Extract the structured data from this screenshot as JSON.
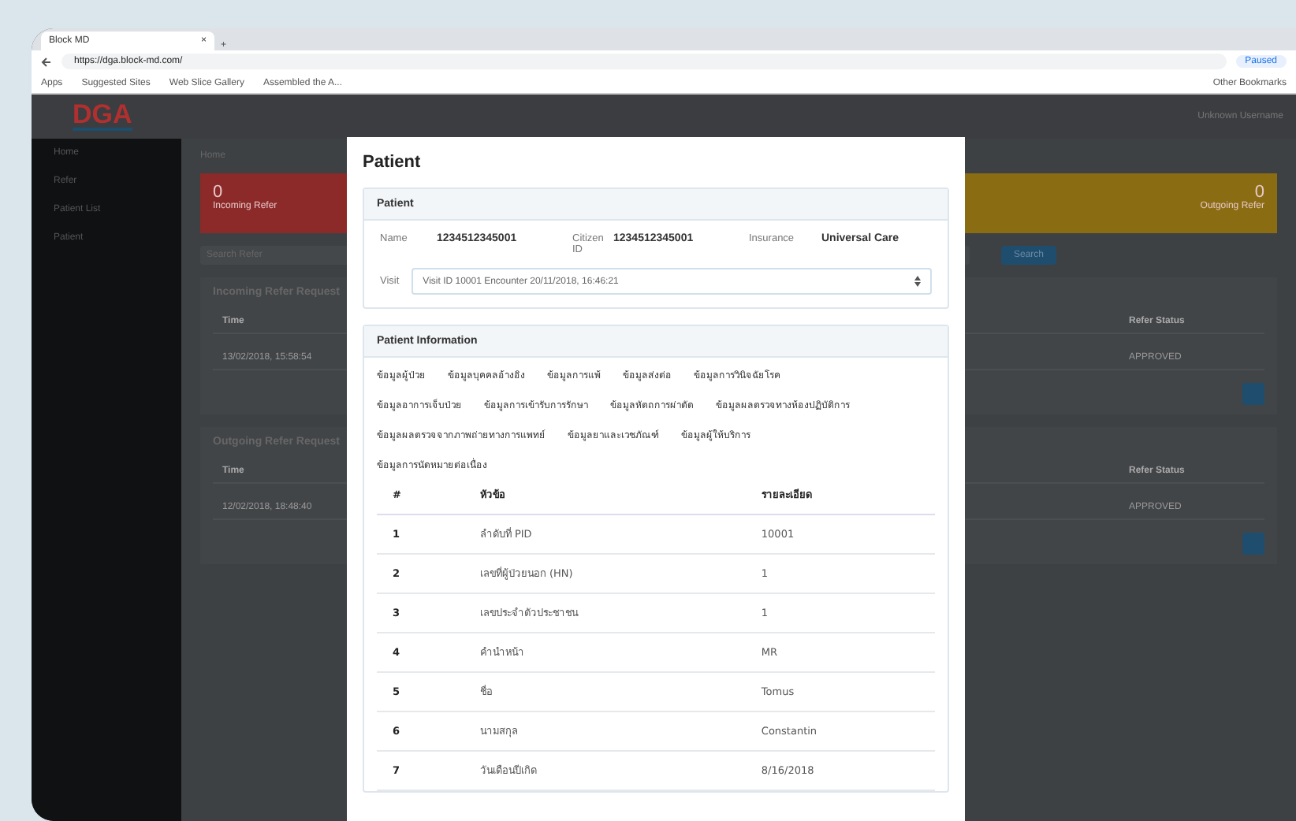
{
  "browser": {
    "tab_title": "Block MD",
    "tab_close": "×",
    "new_tab": "+",
    "url": "https://dga.block-md.com/",
    "profile": "Paused",
    "bookmarks": [
      "Apps",
      "Suggested Sites",
      "Web Slice Gallery",
      "Assembled the A..."
    ],
    "other_bookmarks": "Other Bookmarks"
  },
  "app": {
    "logo": "DGA",
    "user": "Unknown Username",
    "breadcrumb": "Home",
    "sidebar": [
      "Home",
      "Refer",
      "Patient List",
      "Patient"
    ],
    "cards": [
      {
        "value": "0",
        "label": "Incoming Refer",
        "color": "#8c2a2a"
      },
      {
        "value": "0",
        "label": "Outgoing Refer",
        "color": "#8a6d12"
      }
    ],
    "search_text": "Search Refer",
    "search_button": "Search",
    "panels": [
      {
        "title": "Incoming Refer Request",
        "columns": [
          "Time",
          "Refer Status"
        ],
        "rows": [
          [
            "13/02/2018, 15:58:54",
            "APPROVED"
          ]
        ]
      },
      {
        "title": "Outgoing Refer Request",
        "columns": [
          "Time",
          "Refer Status"
        ],
        "rows": [
          [
            "12/02/2018, 18:48:40",
            "APPROVED"
          ]
        ]
      }
    ]
  },
  "modal": {
    "title": "Patient",
    "patient": {
      "title": "Patient",
      "fields": [
        {
          "label": "Name",
          "value": "1234512345001"
        },
        {
          "label": "Citizen ID",
          "value": "1234512345001"
        },
        {
          "label": "Insurance",
          "value": "Universal Care"
        }
      ],
      "visit": {
        "label": "Visit",
        "value": "Visit ID 10001 Encounter 20/11/2018, 16:46:21"
      }
    },
    "info": {
      "title": "Patient Information",
      "tabs": [
        "ข้อมูลผู้ป่วย",
        "ข้อมูลบุคคลอ้างอิง",
        "ข้อมูลการแพ้",
        "ข้อมูลส่งต่อ",
        "ข้อมูลการวินิจฉัยโรค",
        "ข้อมูลอาการเจ็บป่วย",
        "ข้อมูลการเข้ารับการรักษา",
        "ข้อมูลหัตถการผ่าตัด",
        "ข้อมูลผลตรวจทางห้องปฏิบัติการ",
        "ข้อมูลผลตรวจจากภาพถ่ายทางการแพทย์",
        "ข้อมูลยาและเวชภัณฑ์",
        "ข้อมูลผู้ให้บริการ",
        "ข้อมูลการนัดหมายต่อเนื่อง"
      ],
      "columns": [
        "#",
        "หัวข้อ",
        "รายละเอียด"
      ],
      "rows": [
        [
          "1",
          "ลำดับที่ PID",
          "10001"
        ],
        [
          "2",
          "เลขที่ผู้ป่วยนอก (HN)",
          "1"
        ],
        [
          "3",
          "เลขประจำตัวประชาชน",
          "1"
        ],
        [
          "4",
          "คำนำหน้า",
          "MR"
        ],
        [
          "5",
          "ชื่อ",
          "Tomus"
        ],
        [
          "6",
          "นามสกุล",
          "Constantin"
        ],
        [
          "7",
          "วันเดือนปีเกิด",
          "8/16/2018"
        ]
      ]
    }
  }
}
